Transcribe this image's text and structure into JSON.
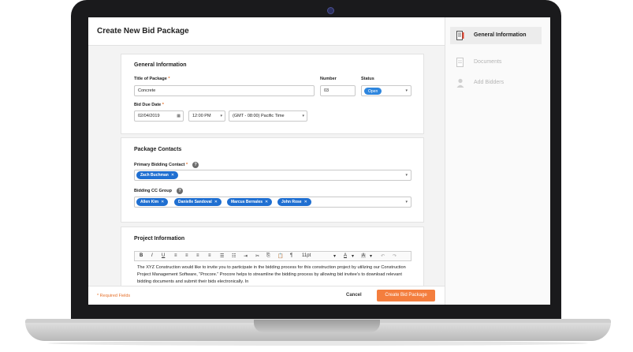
{
  "page": {
    "title": "Create New Bid Package"
  },
  "general": {
    "section_title": "General Information",
    "title_label": "Title of Package",
    "title_value": "Concrete",
    "number_label": "Number",
    "number_value": "03",
    "status_label": "Status",
    "status_value": "Open",
    "due_label": "Bid Due Date",
    "date_value": "02/04/2019",
    "time_value": "12:00 PM",
    "timezone_value": "(GMT - 08:00) Pacific Time",
    "required_mark": "*"
  },
  "contacts": {
    "section_title": "Package Contacts",
    "primary_label": "Primary Bidding Contact",
    "primary_chips": [
      "Zach Buchman"
    ],
    "cc_label": "Bidding CC Group",
    "cc_chips": [
      "Allen Kim",
      "Danielle Sandoval",
      "Marcus Bernales",
      "John Rose"
    ],
    "help_glyph": "?",
    "remove_glyph": "✕"
  },
  "project": {
    "section_title": "Project Information",
    "font_size": "11pt",
    "body_text": "The XYZ Construction would like to invite you to participate in the bidding process for this construction project by utilizing our Construction Project Management Software, “Procore.” Procore helps to streamline the bidding process by allowing bid invitee's to download relevant bidding documents and submit their bids electronically. In"
  },
  "footer": {
    "required_note": "* Required Fields",
    "cancel_label": "Cancel",
    "create_label": "Create Bid Package"
  },
  "sidebar": {
    "items": [
      {
        "label": "General Information",
        "state": "active"
      },
      {
        "label": "Documents",
        "state": "disabled"
      },
      {
        "label": "Add Bidders",
        "state": "disabled"
      }
    ]
  },
  "colors": {
    "accent": "#f47e3e",
    "chip": "#1f6fd1",
    "required": "#e5702a"
  }
}
